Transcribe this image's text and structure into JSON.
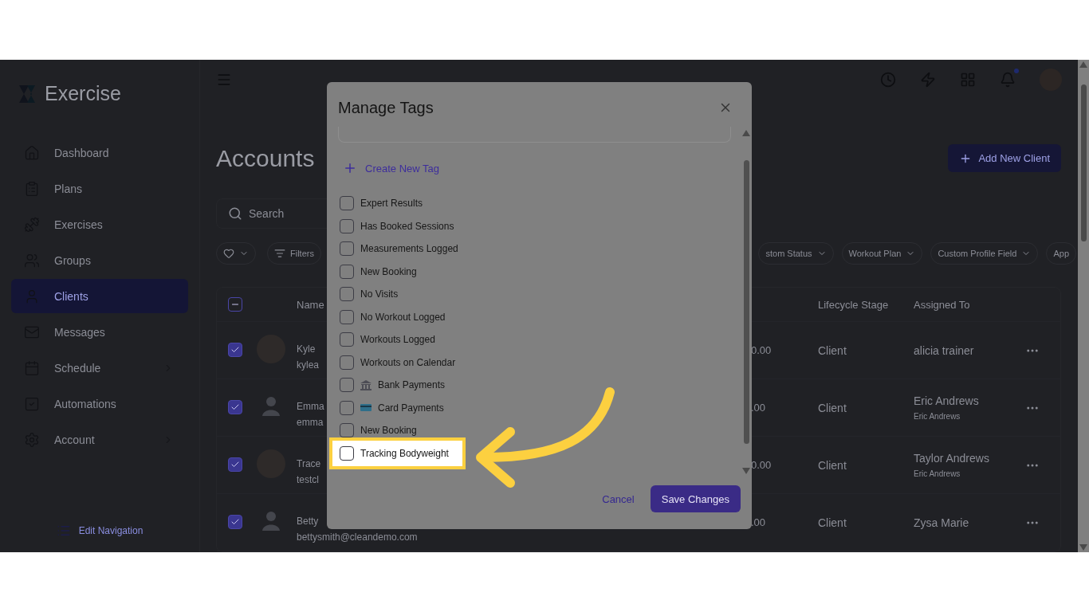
{
  "sidebar": {
    "brand": "Exercise",
    "items": [
      {
        "label": "Dashboard",
        "selected": false,
        "expandable": false
      },
      {
        "label": "Plans",
        "selected": false,
        "expandable": false
      },
      {
        "label": "Exercises",
        "selected": false,
        "expandable": false
      },
      {
        "label": "Groups",
        "selected": false,
        "expandable": false
      },
      {
        "label": "Clients",
        "selected": true,
        "expandable": false
      },
      {
        "label": "Messages",
        "selected": false,
        "expandable": false
      },
      {
        "label": "Schedule",
        "selected": false,
        "expandable": true
      },
      {
        "label": "Automations",
        "selected": false,
        "expandable": false
      },
      {
        "label": "Account",
        "selected": false,
        "expandable": true
      }
    ],
    "edit_link": "Edit Navigation"
  },
  "topbar": {
    "notification_dot": true
  },
  "page": {
    "title": "Accounts",
    "add_button": "Add New Client",
    "search": {
      "placeholder": "Search"
    },
    "filters_label": "Filters",
    "filter_chips": [
      "stom Status",
      "Workout Plan",
      "Custom Profile Field",
      "App"
    ],
    "table": {
      "select_all": {
        "indeterminate": true
      },
      "columns": [
        "Name",
        "Lifecycle Stage",
        "Assigned To"
      ],
      "rows": [
        {
          "checked": true,
          "kind": "photo",
          "name": "Kyle",
          "email": "kylea",
          "column_2": "0.00",
          "lifecycle": "Client",
          "assigned": "alicia trainer"
        },
        {
          "checked": true,
          "kind": "silhouette",
          "name": "Emma",
          "email": "emma",
          "column_2": ".00",
          "lifecycle": "Client",
          "assigned": "Eric Andrews",
          "assigned_sub": "Eric Andrews"
        },
        {
          "checked": true,
          "kind": "photo",
          "name": "Trace",
          "email": "testcl",
          "column_2": "0.00",
          "lifecycle": "Client",
          "assigned": "Taylor Andrews",
          "assigned_sub": "Eric Andrews"
        },
        {
          "checked": true,
          "kind": "silhouette",
          "name": "Betty",
          "email": "bettysmith@cleandemo.com",
          "column_2": ".00",
          "lifecycle": "Client",
          "assigned": "Zysa Marie"
        }
      ]
    }
  },
  "modal": {
    "title": "Manage Tags",
    "create_label": "Create New Tag",
    "tags": [
      {
        "label": "Expert Results",
        "checked": false,
        "kind": "plain",
        "highlighted": false
      },
      {
        "label": "Has Booked Sessions",
        "checked": false,
        "kind": "plain",
        "highlighted": false
      },
      {
        "label": "Measurements Logged",
        "checked": false,
        "kind": "plain",
        "highlighted": false
      },
      {
        "label": "New Booking",
        "checked": false,
        "kind": "plain",
        "highlighted": false
      },
      {
        "label": "No Visits",
        "checked": false,
        "kind": "plain",
        "highlighted": false
      },
      {
        "label": "No Workout Logged",
        "checked": false,
        "kind": "plain",
        "highlighted": false
      },
      {
        "label": "Workouts Logged",
        "checked": false,
        "kind": "plain",
        "highlighted": false
      },
      {
        "label": "Workouts on Calendar",
        "checked": false,
        "kind": "plain",
        "highlighted": false
      },
      {
        "label": "Bank Payments",
        "checked": false,
        "kind": "bank",
        "highlighted": false
      },
      {
        "label": "Card Payments",
        "checked": false,
        "kind": "card",
        "highlighted": false
      },
      {
        "label": "New Booking",
        "checked": false,
        "kind": "plain",
        "highlighted": false
      },
      {
        "label": "Tracking Bodyweight",
        "checked": false,
        "kind": "plain",
        "highlighted": true
      }
    ],
    "cancel": "Cancel",
    "save": "Save Changes"
  }
}
